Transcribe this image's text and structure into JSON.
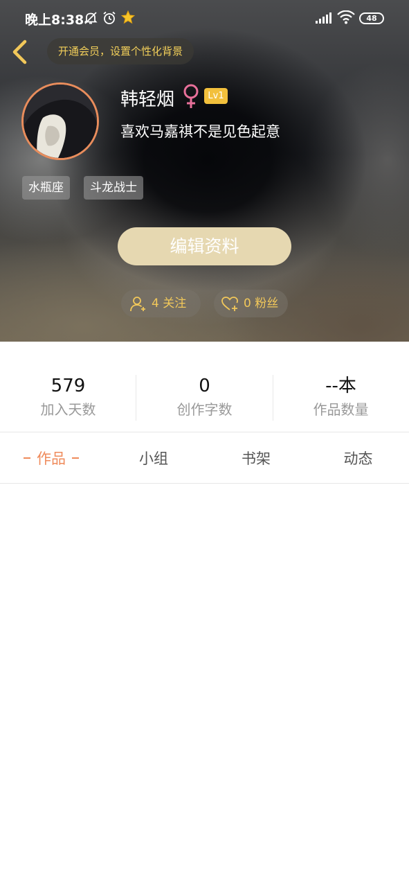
{
  "status_bar": {
    "time": "晚上8:38",
    "battery": "48",
    "icons": [
      "bell-off-icon",
      "alarm-icon",
      "star-icon",
      "signal-icon",
      "wifi-icon",
      "battery-icon"
    ]
  },
  "nav": {
    "back_icon": "chevron-left-icon",
    "vip_banner": "开通会员，设置个性化背景"
  },
  "profile": {
    "username": "韩轻烟",
    "gender_icon": "female-icon",
    "level": "Lv1",
    "bio": "喜欢马嘉祺不是见色起意",
    "tags": [
      "水瓶座",
      "斗龙战士"
    ],
    "edit_button": "编辑资料",
    "following": "4 关注",
    "fans": "0 粉丝"
  },
  "stats": [
    {
      "value": "579",
      "label": "加入天数"
    },
    {
      "value": "0",
      "label": "创作字数"
    },
    {
      "value": "--本",
      "label": "作品数量"
    }
  ],
  "tabs": [
    "作品",
    "小组",
    "书架",
    "动态"
  ],
  "colors": {
    "accent": "#ef8a5a",
    "gold": "#f2c85a",
    "level_badge": "#f2c03c",
    "edit_button": "#e6d8b1",
    "female_icon": "#e8709a"
  }
}
